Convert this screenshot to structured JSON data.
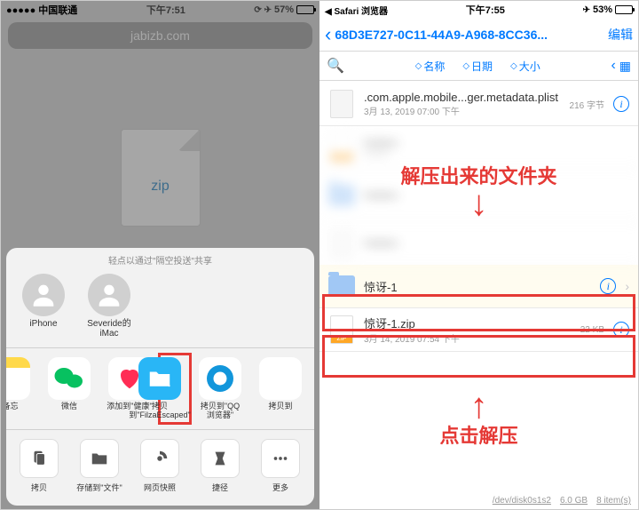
{
  "left": {
    "status": {
      "carrier": "●●●●● 中国联通",
      "wifi": "📶",
      "time": "下午7:51",
      "icons": "⟳ ✈︎",
      "battery": "57%",
      "battery_pct": 57
    },
    "url": "jabizb.com",
    "zip_label": "zip",
    "share_hint": "轻点以通过\"隔空投送\"共享",
    "airdrop": [
      {
        "label": "iPhone"
      },
      {
        "label": "Severide的\niMac"
      }
    ],
    "apps": [
      {
        "label": "\"备忘"
      },
      {
        "label": "微信"
      },
      {
        "label": "添加到\"健康\""
      },
      {
        "label": "拷贝\n到\"FilzaEscaped\""
      },
      {
        "label": "拷贝到\"QQ\n浏览器\""
      },
      {
        "label": "拷贝到"
      }
    ],
    "actions": [
      {
        "label": "拷贝"
      },
      {
        "label": "存储到\"文件\""
      },
      {
        "label": "网页快照"
      },
      {
        "label": "捷径"
      },
      {
        "label": "更多"
      }
    ]
  },
  "right": {
    "status": {
      "app": "◀ Safari 浏览器",
      "sig": "••ıll 📶",
      "time": "下午7:55",
      "icons": "✈︎",
      "battery": "53%",
      "battery_pct": 53
    },
    "nav": {
      "title": "68D3E727-0C11-44A9-A968-8CC36...",
      "edit": "编辑"
    },
    "toolbar": {
      "sort_name": "名称",
      "sort_date": "日期",
      "sort_size": "大小"
    },
    "files": {
      "plist": {
        "name": ".com.apple.mobile...ger.metadata.plist",
        "meta": "3月 13, 2019 07:00 下午",
        "size": "216 字节"
      },
      "folder": {
        "name": "惊讶-1"
      },
      "zip": {
        "name": "惊讶-1.zip",
        "meta": "3月 14, 2019 07:54 下午",
        "size": "22 KB"
      }
    },
    "footer": {
      "disk": "/dev/disk0s1s2",
      "free": "6.0 GB",
      "items": "8 item(s)"
    },
    "annotations": {
      "top": "解压出来的文件夹",
      "bottom": "点击解压"
    }
  }
}
